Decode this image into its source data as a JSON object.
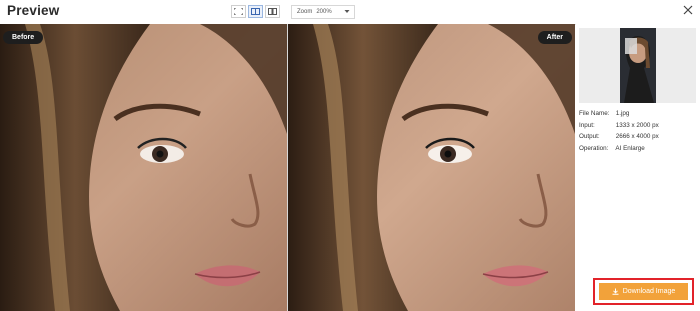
{
  "header": {
    "title": "Preview",
    "view_modes": [
      {
        "icon": "fit-screen-icon",
        "active": false
      },
      {
        "icon": "split-view-icon",
        "active": true
      },
      {
        "icon": "side-by-side-icon",
        "active": false
      }
    ],
    "zoom": {
      "label": "Zoom",
      "value": "200%"
    }
  },
  "before_label": "Before",
  "after_label": "After",
  "info": {
    "file_name_label": "File Name:",
    "file_name": "1.jpg",
    "input_label": "Input:",
    "input": "1333 x 2000 px",
    "output_label": "Output:",
    "output": "2666 x 4000 px",
    "operation_label": "Operation:",
    "operation": "AI Enlarge"
  },
  "download_label": "Download Image",
  "colors": {
    "download_button": "#f2a23a",
    "highlight_frame": "#e2232a",
    "tag_background": "#1e1e1e"
  }
}
